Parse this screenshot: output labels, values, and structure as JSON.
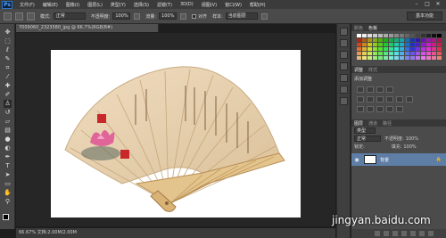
{
  "app": {
    "logo": "Ps"
  },
  "menu": [
    "文件(F)",
    "编辑(E)",
    "图像(I)",
    "图层(L)",
    "类型(Y)",
    "选择(S)",
    "滤镜(T)",
    "3D(D)",
    "视图(V)",
    "窗口(W)",
    "帮助(H)"
  ],
  "window_controls": [
    "–",
    "□",
    "✕"
  ],
  "options": {
    "mode_label": "模式:",
    "mode_value": "正常",
    "opacity_label": "不透明度:",
    "opacity_value": "100%",
    "flow_label": "流量:",
    "flow_value": "100%",
    "align_label": "对齐",
    "sample_label": "样本:",
    "sample_value": "当前图层",
    "workspace_button": "基本功能"
  },
  "document": {
    "tab_title": "7009060_2323580_jpg @ 66.7%(RGB/8#)",
    "status": "66.67%  文档:2.00M/2.00M"
  },
  "panels": {
    "swatches_tabs": [
      "颜色",
      "色板"
    ],
    "adjust_tabs": [
      "调整",
      "样式"
    ],
    "adjust_title": "添加调整",
    "layers_tabs": [
      "图层",
      "通道",
      "路径"
    ],
    "kind_label": "类型",
    "blend_mode": "正常",
    "opacity_label": "不透明度:",
    "opacity_value": "100%",
    "lock_label": "锁定:",
    "fill_label": "填充:",
    "fill_value": "100%",
    "layer_name": "背景",
    "lock_icon": "🔒"
  },
  "watermark": "jingyan.baidu.com",
  "tools": [
    "move-icon",
    "marquee-icon",
    "lasso-icon",
    "quick-select-icon",
    "crop-icon",
    "eyedropper-icon",
    "healing-icon",
    "brush-icon",
    "clone-stamp-icon",
    "history-brush-icon",
    "eraser-icon",
    "gradient-icon",
    "blur-icon",
    "dodge-icon",
    "pen-icon",
    "type-icon",
    "path-select-icon",
    "shape-icon",
    "hand-icon",
    "zoom-icon"
  ]
}
